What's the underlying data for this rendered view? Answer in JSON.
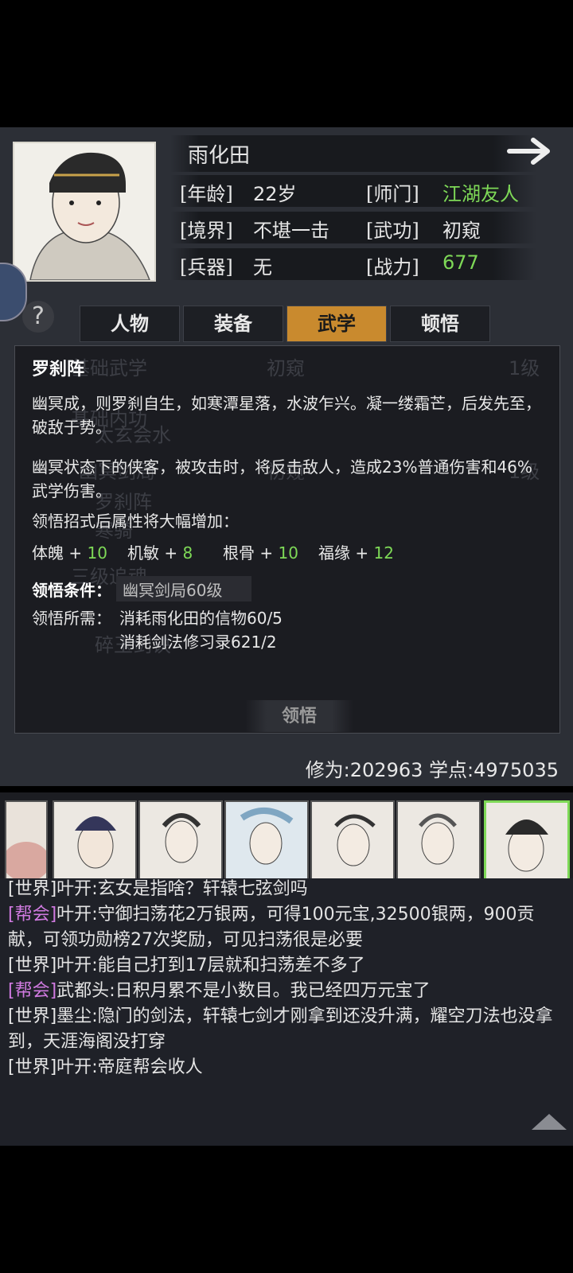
{
  "character": {
    "name": "雨化田",
    "fields": [
      {
        "label": "[年龄]",
        "value": "22岁"
      },
      {
        "label": "[师门]",
        "value": "江湖友人"
      },
      {
        "label": "[境界]",
        "value": "不堪一击"
      },
      {
        "label": "[武功]",
        "value": "初窥"
      },
      {
        "label": "[兵器]",
        "value": "无"
      },
      {
        "label": "[战力]",
        "value": "677"
      }
    ]
  },
  "help_label": "?",
  "tabs": [
    "人物",
    "装备",
    "武学",
    "顿悟"
  ],
  "active_tab": "武学",
  "background_list": {
    "row1": {
      "name": "基础武学",
      "level": "初窥",
      "grade": "1级"
    },
    "row2": {
      "name": "基础内功"
    },
    "row3": {
      "name": "太玄会水"
    },
    "row4": {
      "name": "幽冥剑局",
      "level": "初窥",
      "grade": "1级"
    },
    "row5": {
      "name": "罗刹阵"
    },
    "row6": {
      "name": "寒骑"
    },
    "row7": {
      "name": "三级追魂"
    },
    "row8": {
      "name": "碎玉剑诀"
    }
  },
  "popup": {
    "title": "罗刹阵",
    "desc1": "幽冥成，则罗刹自生，如寒潭星落，水波乍兴。凝一缕霜芒，后发先至，破敌于势。",
    "desc2": "幽冥状态下的侠客，被攻击时，将反击敌人，造成23%普通伤害和46%武学伤害。",
    "desc3": "领悟招式后属性将大幅增加：",
    "stats": [
      {
        "name": "体魄",
        "plus": "+",
        "value": "10"
      },
      {
        "name": "机敏",
        "plus": "+",
        "value": "8"
      },
      {
        "name": "根骨",
        "plus": "+",
        "value": "10"
      },
      {
        "name": "福缘",
        "plus": "+",
        "value": "12"
      }
    ],
    "cond_label": "领悟条件：",
    "cond_value": "幽冥剑局60级",
    "need_label": "领悟所需：",
    "need1": "消耗雨化田的信物60/5",
    "need2": "消耗剑法修习录621/2",
    "button": "领悟"
  },
  "footer_stats": "修为:202963  学点:4975035",
  "chat": [
    {
      "channel": "[世界]",
      "speaker": "叶开",
      "text": ":玄女是指啥？轩辕七弦剑吗"
    },
    {
      "channel": "[帮会]",
      "speaker": "叶开",
      "text": ":守御扫荡花2万银两，可得100元宝,32500银两，900贡献，可领功勋榜27次奖励，可见扫荡很是必要"
    },
    {
      "channel": "[世界]",
      "speaker": "叶开",
      "text": ":能自己打到17层就和扫荡差不多了"
    },
    {
      "channel": "[帮会]",
      "speaker": "武都头",
      "text": ":日积月累不是小数目。我已经四万元宝了"
    },
    {
      "channel": "[世界]",
      "speaker": "墨尘",
      "text": ":隐门的剑法，轩辕七剑才刚拿到还没升满，耀空刀法也没拿到，天涯海阁没打穿"
    },
    {
      "channel": "[世界]",
      "speaker": "叶开",
      "text": ":帝庭帮会收人"
    }
  ],
  "colors": {
    "accent_tab": "#c98a2e",
    "green": "#7ed957",
    "guild": "#d07ae0"
  }
}
